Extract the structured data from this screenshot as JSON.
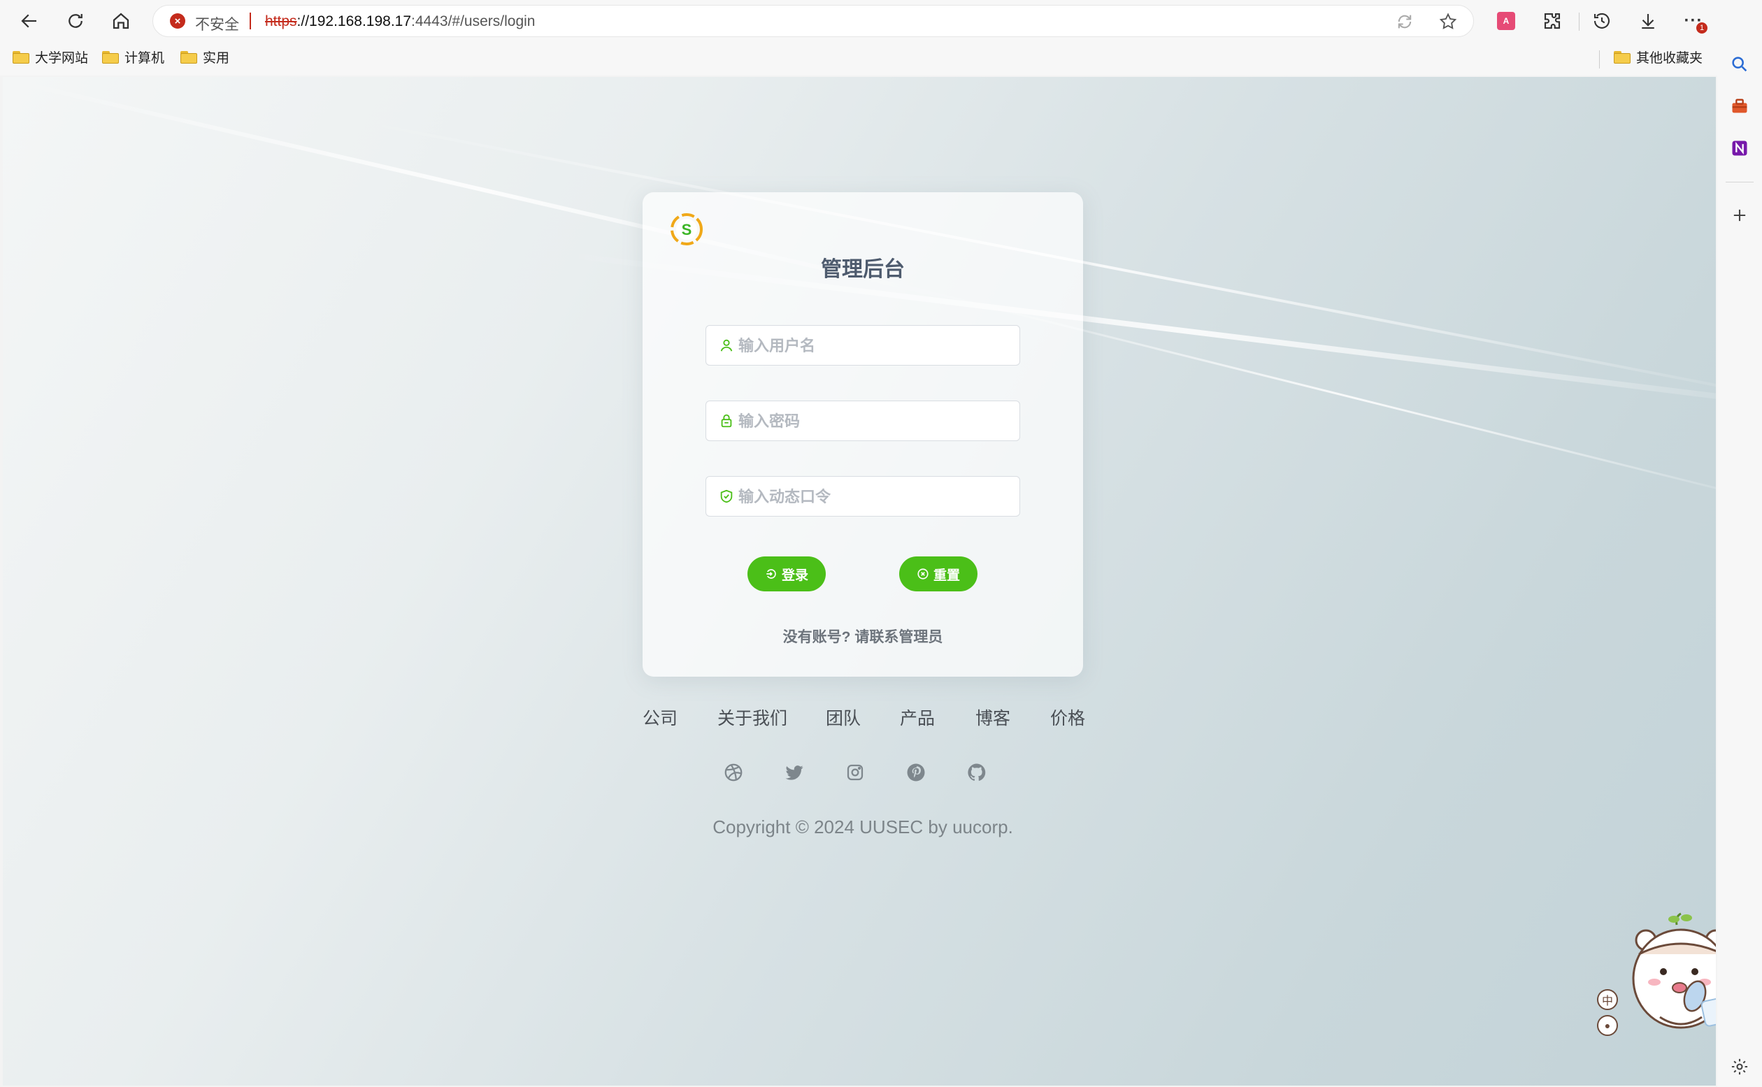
{
  "browser": {
    "security_label": "不安全",
    "url": {
      "scheme": "https",
      "host": "://192.168.198.17",
      "rest": ":4443/#/users/login"
    },
    "translate_badge": "A",
    "more_badge": "1",
    "bookmarks": [
      "大学网站",
      "计算机",
      "实用"
    ],
    "other_bookmarks": "其他收藏夹"
  },
  "login": {
    "title": "管理后台",
    "username_placeholder": "输入用户名",
    "password_placeholder": "输入密码",
    "otp_placeholder": "输入动态口令",
    "login_button": "登录",
    "reset_button": "重置",
    "contact_text": "没有账号? 请联系管理员",
    "logo_letter": "S"
  },
  "footer": {
    "links": [
      "公司",
      "关于我们",
      "团队",
      "产品",
      "博客",
      "价格"
    ],
    "socials": [
      "dribbble-icon",
      "twitter-icon",
      "instagram-icon",
      "pinterest-icon",
      "github-icon"
    ],
    "copyright": "Copyright © 2024 UUSEC by uucorp."
  },
  "widget": {
    "lang_label": "中"
  },
  "colors": {
    "accent": "#4bbf18",
    "title": "#4e5b6e",
    "insecure": "#c42b1c"
  }
}
